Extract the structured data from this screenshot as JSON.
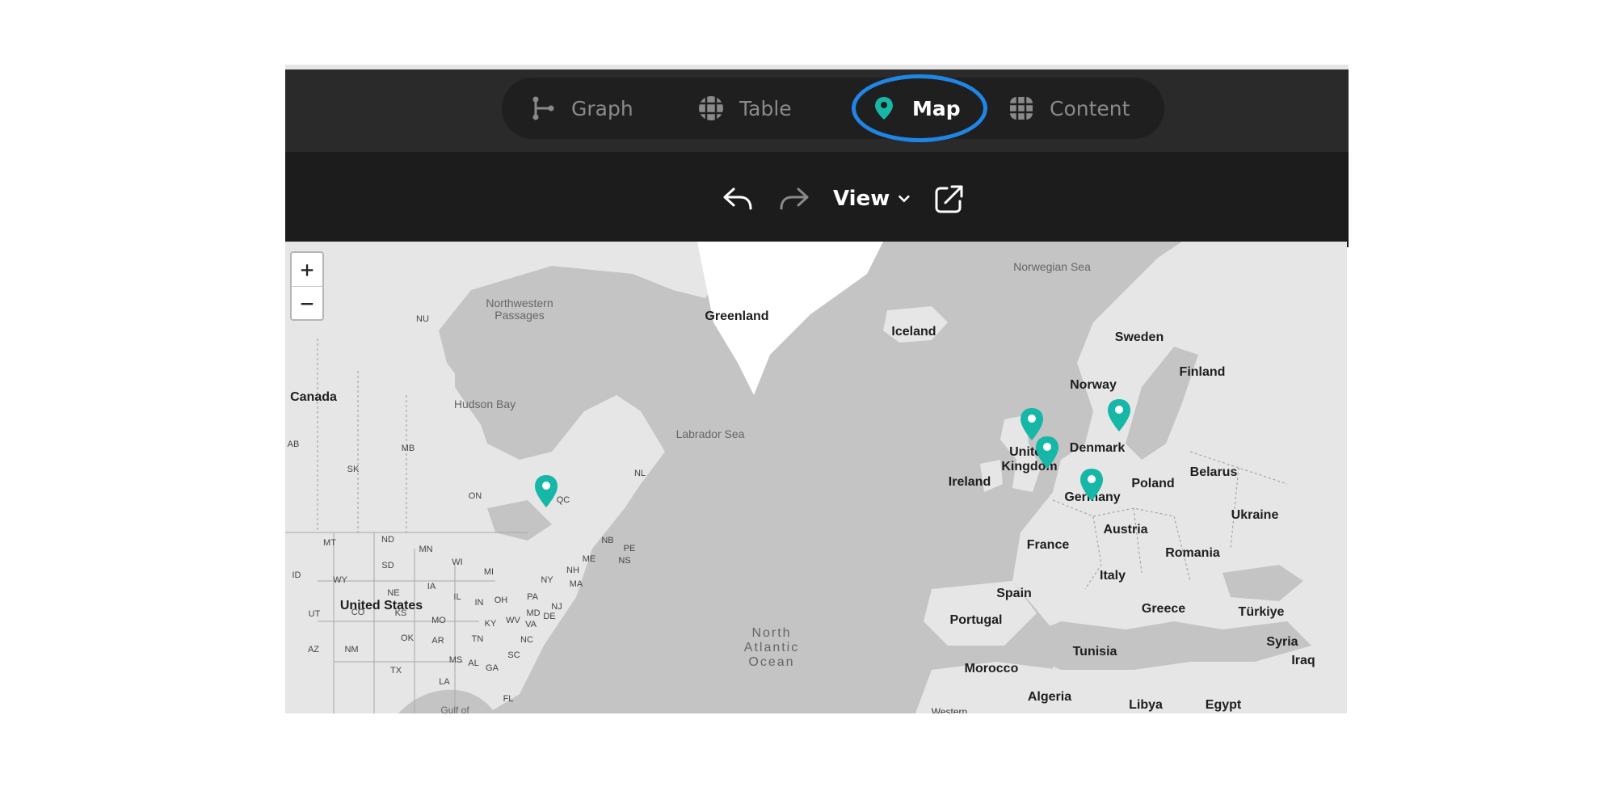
{
  "tabs": {
    "graph": "Graph",
    "table": "Table",
    "map": "Map",
    "content": "Content"
  },
  "toolbar": {
    "view_label": "View"
  },
  "zoom": {
    "in": "+",
    "out": "−"
  },
  "map_labels": {
    "countries": [
      "Greenland",
      "Iceland",
      "Canada",
      "United States",
      "Sweden",
      "Finland",
      "Norway",
      "Denmark",
      "United Kingdom",
      "Ireland",
      "Germany",
      "Poland",
      "Belarus",
      "Ukraine",
      "France",
      "Austria",
      "Romania",
      "Italy",
      "Spain",
      "Portugal",
      "Greece",
      "Türkiye",
      "Syria",
      "Iraq",
      "Tunisia",
      "Morocco",
      "Algeria",
      "Libya",
      "Egypt"
    ],
    "waters": [
      "Norwegian Sea",
      "Northwestern Passages",
      "Hudson Bay",
      "Labrador Sea",
      "North Atlantic Ocean",
      "Gulf of",
      "Western"
    ],
    "states": [
      "NU",
      "AB",
      "MB",
      "SK",
      "ON",
      "QC",
      "NL",
      "NB",
      "PE",
      "NS",
      "MT",
      "ND",
      "MN",
      "WI",
      "MI",
      "NY",
      "ME",
      "NH",
      "MA",
      "ID",
      "WY",
      "SD",
      "IA",
      "IL",
      "IN",
      "OH",
      "PA",
      "NJ",
      "MD",
      "DE",
      "WV",
      "VA",
      "KY",
      "MO",
      "NE",
      "UT",
      "CO",
      "KS",
      "OK",
      "AR",
      "TN",
      "NC",
      "SC",
      "AZ",
      "NM",
      "TX",
      "MS",
      "AL",
      "GA",
      "LA",
      "FL"
    ]
  },
  "colors": {
    "accent_ring": "#1f86e6",
    "pin": "#17b7a8",
    "tabbar": "#2a2a2a",
    "toolbar": "#1c1c1c",
    "water": "#c4c4c4",
    "land": "#e8e8e8"
  },
  "icons": {
    "graph": "graph-branch-icon",
    "table": "grid-icon",
    "map": "map-pin-icon",
    "content": "content-grid-icon",
    "undo": "undo-icon",
    "redo": "redo-icon",
    "view_dropdown": "chevron-down-icon",
    "share": "external-share-icon"
  }
}
